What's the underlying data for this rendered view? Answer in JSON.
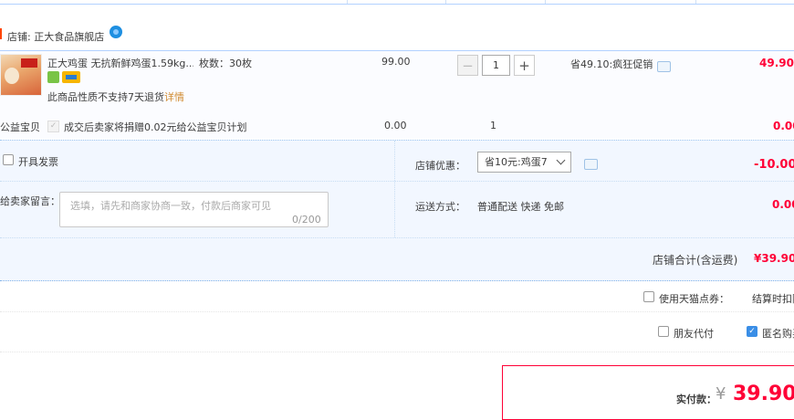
{
  "shop": {
    "label": "店铺: 正大食品旗舰店",
    "wangwang_icon": "chat-bubble-icon"
  },
  "item": {
    "title": "正大鸡蛋 无抗新鲜鸡蛋1.59kg...",
    "spec": "枚数：30枚",
    "notice": "此商品性质不支持7天退货",
    "detail_link": "详情",
    "price": "99.00",
    "quantity": "1",
    "qty_minus": "−",
    "qty_plus": "+",
    "promo": "省49.10:疯狂促销",
    "subtotal": "49.90"
  },
  "charity": {
    "label": "公益宝贝",
    "text": "成交后卖家将捐赠0.02元给公益宝贝计划",
    "price": "0.00",
    "quantity": "1",
    "subtotal": "0.00"
  },
  "invoice": {
    "label": "开具发票",
    "checked": false
  },
  "shop_coupon": {
    "label": "店铺优惠：",
    "selected": "省10元:鸡蛋7",
    "value": "-10.00"
  },
  "message": {
    "label": "给卖家留言：",
    "placeholder": "选填，请先和商家协商一致，付款后商家可见",
    "counter": "0/200"
  },
  "shipping": {
    "label": "运送方式：",
    "value": "普通配送 快递 免邮",
    "price": "0.00"
  },
  "shop_total": {
    "label": "店铺合计(含运费)",
    "value": "¥39.90"
  },
  "tmall_points": {
    "label": "使用天猫点券：",
    "checked": false,
    "settle_text": "结算时扣除"
  },
  "friend_pay": {
    "label": "朋友代付",
    "checked": false
  },
  "anonymous": {
    "label": "匿名购买",
    "checked": true
  },
  "pay": {
    "label": "实付款：",
    "currency": "¥",
    "amount": "39.90"
  },
  "colors": {
    "accent": "#ff0036",
    "link": "#d08a2f",
    "panel_bg": "#f2f7ff",
    "border_blue": "#b2d1ff"
  }
}
